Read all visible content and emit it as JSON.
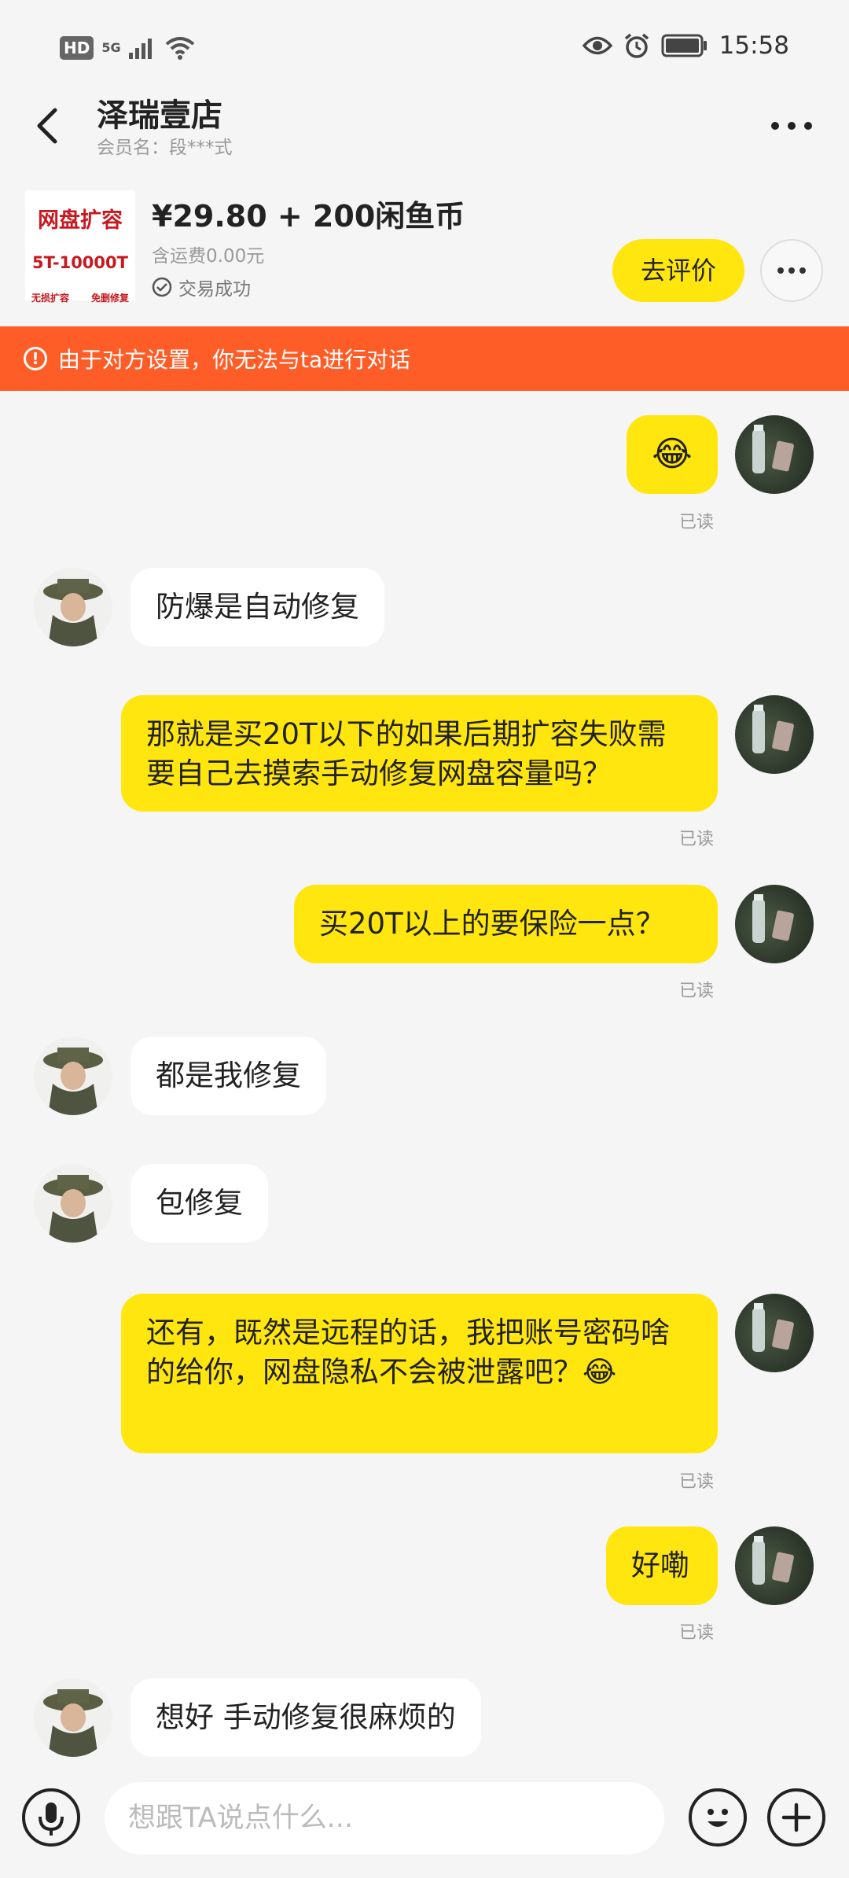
{
  "status_bar": {
    "hd_label": "HD",
    "network_label": "5G",
    "time": "15:58",
    "icons": [
      "signal-icon",
      "wifi-icon",
      "eye-icon",
      "alarm-icon",
      "battery-icon"
    ]
  },
  "header": {
    "title": "泽瑞壹店",
    "member_label": "会员名：段***式"
  },
  "product": {
    "thumb_title": "网盘扩容",
    "thumb_sub": "5T-10000T",
    "thumb_tag_left": "无损扩容",
    "thumb_tag_right": "免删修复",
    "price": "¥29.80 + 200闲鱼币",
    "shipping": "含运费0.00元",
    "status": "交易成功",
    "review_button": "去评价"
  },
  "banner": {
    "text": "由于对方设置，你无法与ta进行对话"
  },
  "chat": {
    "messages": [
      {
        "side": "me",
        "text": "😂",
        "read": "已读"
      },
      {
        "side": "them",
        "text": "防爆是自动修复"
      },
      {
        "side": "me",
        "text": "那就是买20T以下的如果后期扩容失败需要自己去摸索手动修复网盘容量吗？",
        "read": "已读"
      },
      {
        "side": "me",
        "text": "买20T以上的要保险一点？",
        "read": "已读"
      },
      {
        "side": "them",
        "text": "都是我修复"
      },
      {
        "side": "them",
        "text": "包修复"
      },
      {
        "side": "me",
        "text": "还有，既然是远程的话，我把账号密码啥的给你，网盘隐私不会被泄露吧？😂",
        "read": "已读"
      },
      {
        "side": "me",
        "text": "好嘞",
        "read": "已读"
      },
      {
        "side": "them",
        "text": "想好 手动修复很麻烦的"
      }
    ]
  },
  "input_bar": {
    "placeholder": "想跟TA说点什么..."
  },
  "colors": {
    "accent_yellow": "#ffe60f",
    "banner_orange": "#ff5d28",
    "background": "#f5f5f5"
  }
}
